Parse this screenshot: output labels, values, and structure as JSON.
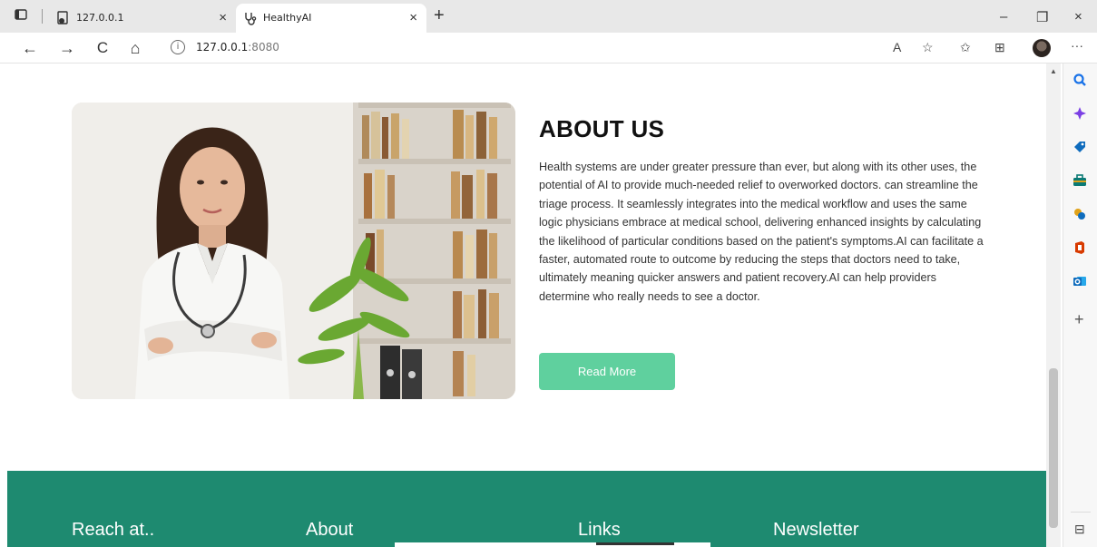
{
  "browser": {
    "tabs": [
      {
        "title": "127.0.0.1",
        "active": false
      },
      {
        "title": "HealthyAI",
        "active": true
      }
    ],
    "address": {
      "host": "127.0.0.1",
      "port": ":8080"
    },
    "icons": {
      "tab_actions": "tab-actions-icon",
      "new_tab": "plus-icon",
      "back": "back-arrow-icon",
      "forward": "forward-arrow-icon",
      "refresh": "refresh-icon",
      "home": "home-icon",
      "read_aloud": "read-aloud-icon",
      "favorite": "add-favorite-icon",
      "favorites": "favorites-icon",
      "collections": "collections-icon",
      "more": "more-icon"
    },
    "glyphs": {
      "close": "×",
      "plus": "+",
      "minimize": "–",
      "restore": "❐",
      "back": "←",
      "forward": "→",
      "refresh": "C",
      "home": "⌂",
      "info": "i",
      "read_aloud": "A",
      "favorite": "☆",
      "favorites": "✩",
      "collections": "⊞",
      "more": "···"
    }
  },
  "sidebar": {
    "items": [
      {
        "name": "search-icon",
        "color": "#1a73e8"
      },
      {
        "name": "copilot-icon",
        "color": "#7b3fe4"
      },
      {
        "name": "shopping-icon",
        "color": "#0f6cbd"
      },
      {
        "name": "tools-icon",
        "color": "#0b7a75"
      },
      {
        "name": "games-icon",
        "color": "#e0a21a"
      },
      {
        "name": "office-icon",
        "color": "#d83b01"
      },
      {
        "name": "outlook-icon",
        "color": "#0f6cbd"
      }
    ],
    "add_glyph": "+",
    "bottom_glyph": "⊟"
  },
  "page": {
    "about": {
      "title": "ABOUT US",
      "text": "Health systems are under greater pressure than ever, but along with its other uses, the potential of AI to provide much-needed relief to overworked doctors. can streamline the triage process. It seamlessly integrates into the medical workflow and uses the same logic physicians embrace at medical school, delivering enhanced insights by calculating the likelihood of particular conditions based on the patient's symptoms.AI can facilitate a faster, automated route to outcome by reducing the steps that doctors need to take, ultimately meaning quicker answers and patient recovery.AI can help providers determine who really needs to see a doctor.",
      "button_label": "Read More"
    },
    "footer": {
      "headings": [
        "Reach at..",
        "About",
        "Links",
        "Newsletter"
      ]
    },
    "colors": {
      "accent": "#5fd09e",
      "footer": "#1e8a70"
    }
  }
}
